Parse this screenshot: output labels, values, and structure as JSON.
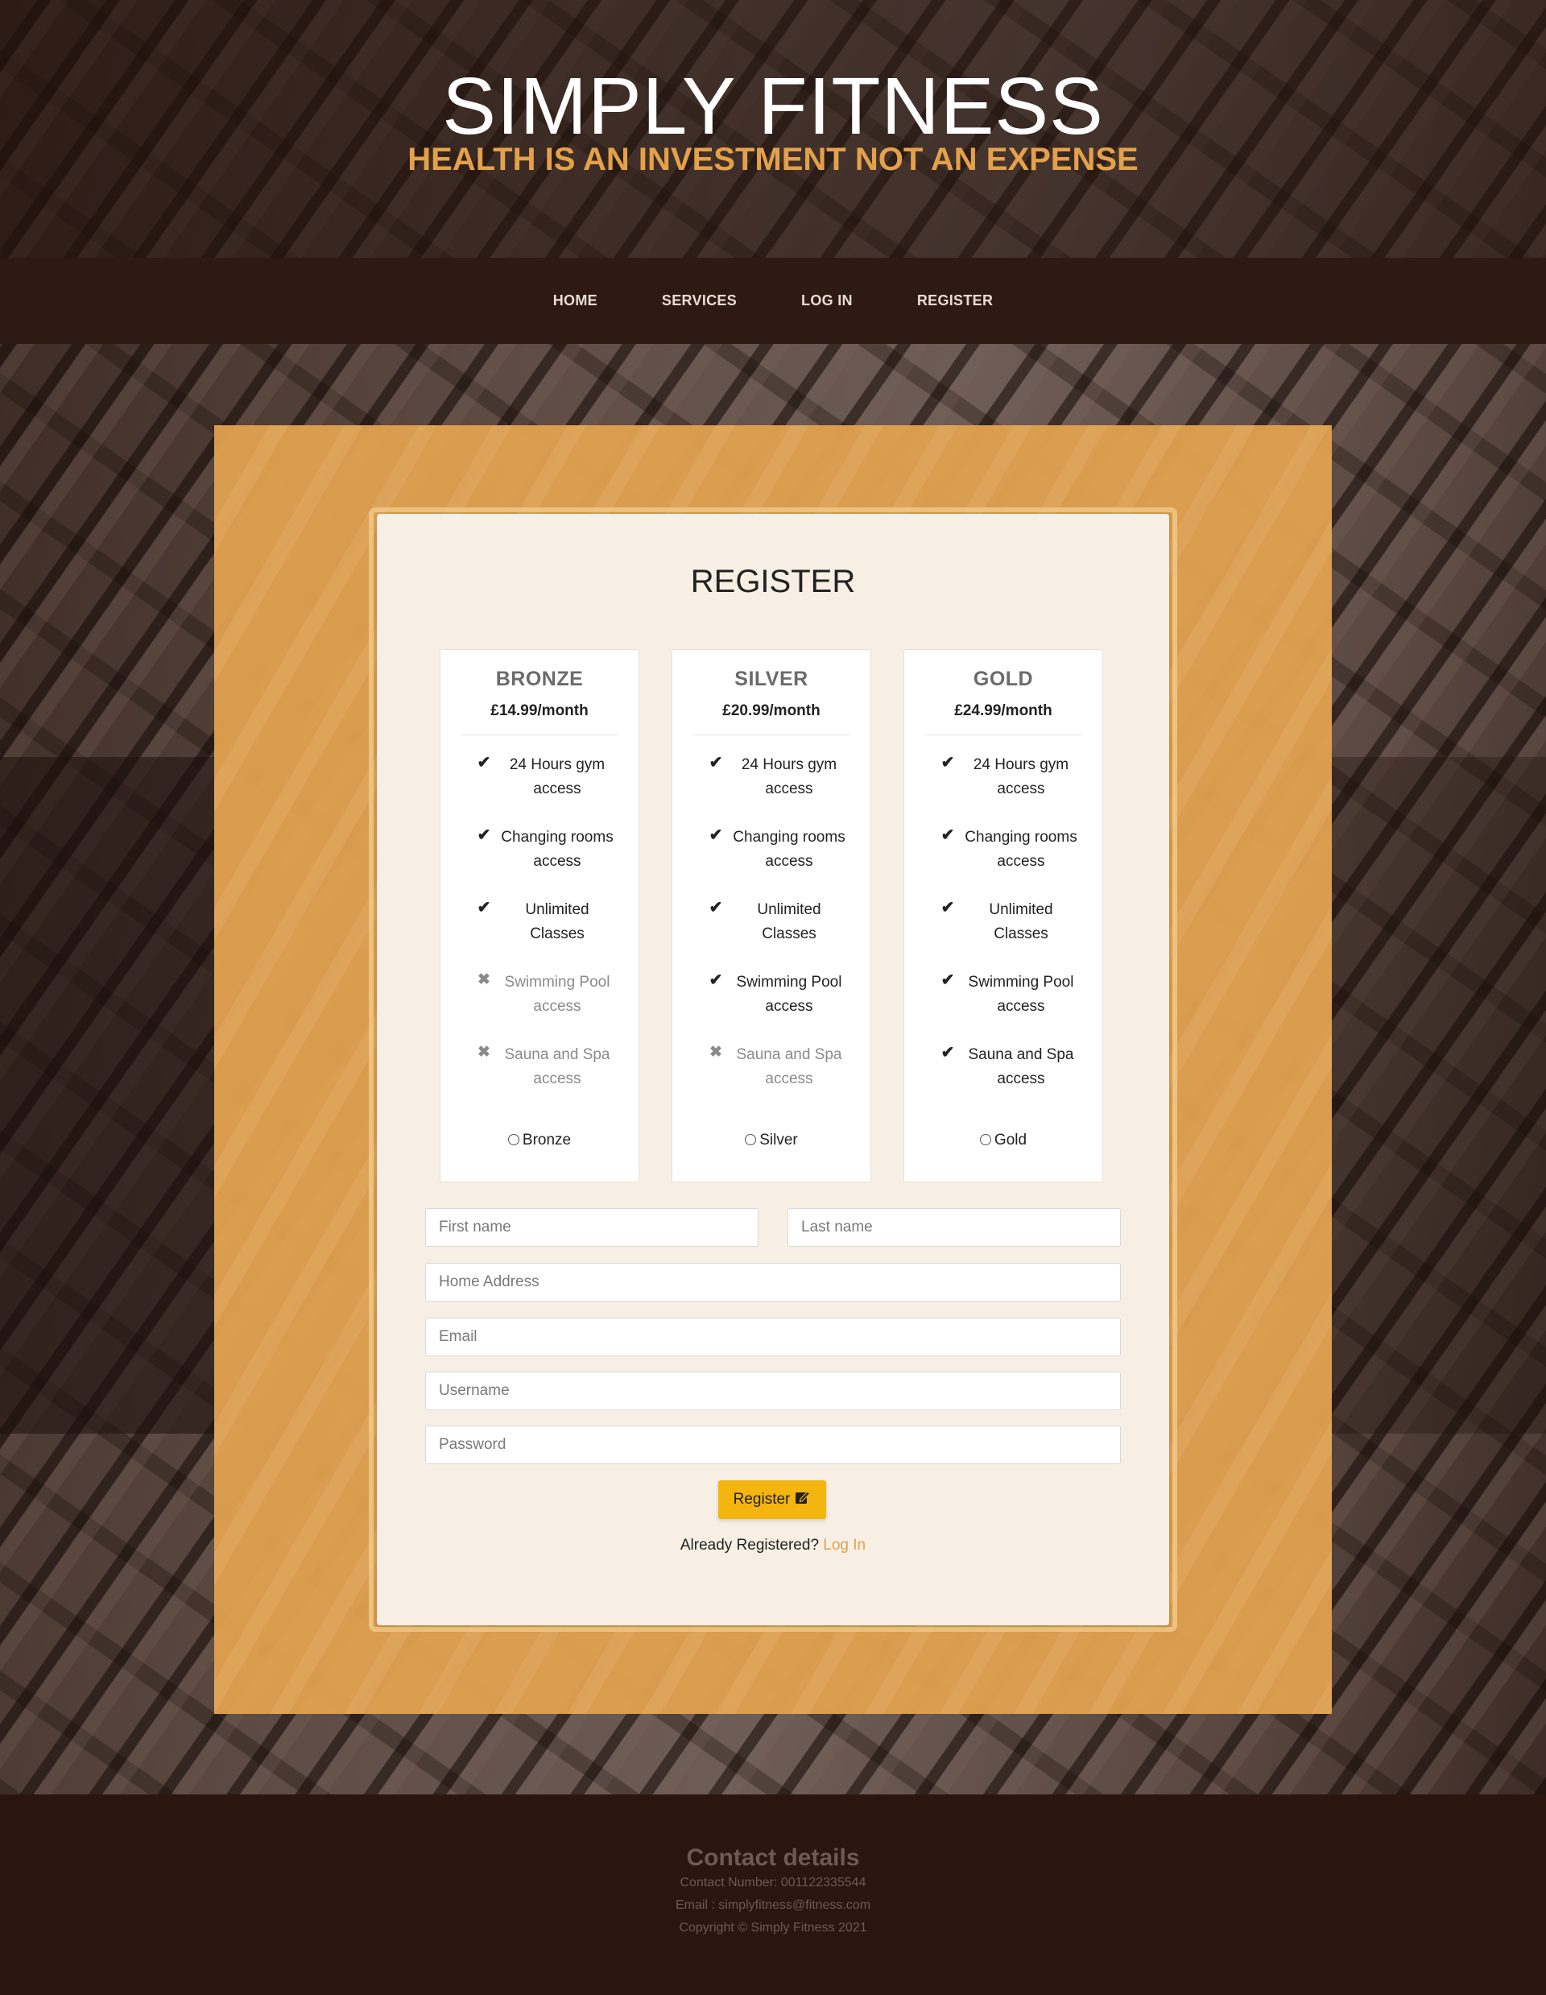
{
  "header": {
    "title": "SIMPLY FITNESS",
    "tagline": "HEALTH IS AN INVESTMENT NOT AN EXPENSE"
  },
  "nav": {
    "items": [
      {
        "label": "HOME"
      },
      {
        "label": "SERVICES"
      },
      {
        "label": "LOG IN"
      },
      {
        "label": "REGISTER"
      }
    ]
  },
  "register": {
    "title": "REGISTER",
    "plans": [
      {
        "name": "BRONZE",
        "price": "£14.99/month",
        "radio_label": "Bronze",
        "features": [
          {
            "text": "24 Hours gym access",
            "included": true
          },
          {
            "text": "Changing rooms access",
            "included": true
          },
          {
            "text": "Unlimited Classes",
            "included": true
          },
          {
            "text": "Swimming Pool access",
            "included": false
          },
          {
            "text": "Sauna and Spa access",
            "included": false
          }
        ]
      },
      {
        "name": "SILVER",
        "price": "£20.99/month",
        "radio_label": "Silver",
        "features": [
          {
            "text": "24 Hours gym access",
            "included": true
          },
          {
            "text": "Changing rooms access",
            "included": true
          },
          {
            "text": "Unlimited Classes",
            "included": true
          },
          {
            "text": "Swimming Pool access",
            "included": true
          },
          {
            "text": "Sauna and Spa access",
            "included": false
          }
        ]
      },
      {
        "name": "GOLD",
        "price": "£24.99/month",
        "radio_label": "Gold",
        "features": [
          {
            "text": "24 Hours gym access",
            "included": true
          },
          {
            "text": "Changing rooms access",
            "included": true
          },
          {
            "text": "Unlimited Classes",
            "included": true
          },
          {
            "text": "Swimming Pool access",
            "included": true
          },
          {
            "text": "Sauna and Spa access",
            "included": true
          }
        ]
      }
    ],
    "fields": {
      "first_name": "First name",
      "last_name": "Last name",
      "address": "Home Address",
      "email": "Email",
      "username": "Username",
      "password": "Password"
    },
    "button_label": "Register",
    "already_text": "Already Registered?",
    "login_link": "Log In"
  },
  "icons": {
    "check": "check-icon",
    "cross": "x-icon",
    "register": "pen-square-icon"
  },
  "colors": {
    "accent_orange": "#e3a14a",
    "button_yellow": "#f5b50f",
    "nav_bg": "#2f1a13",
    "footer_bg": "#2a150f"
  },
  "footer": {
    "title": "Contact details",
    "contact": "Contact Number: 001122335544",
    "email": "Email : simplyfitness@fitness.com",
    "copyright": "Copyright © Simply Fitness 2021"
  }
}
